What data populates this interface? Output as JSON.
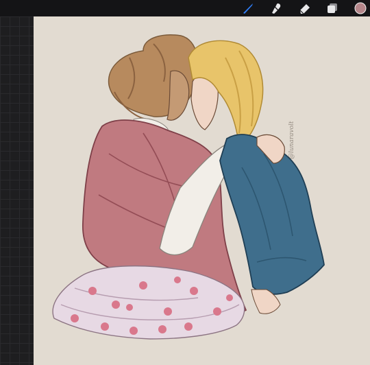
{
  "toolbar": {
    "tools": [
      {
        "name": "brush",
        "icon": "brush-icon",
        "color": "#2f7df6",
        "active": true
      },
      {
        "name": "smudge",
        "icon": "smudge-icon",
        "color": "#e8e8ea",
        "active": false
      },
      {
        "name": "eraser",
        "icon": "eraser-icon",
        "color": "#e8e8ea",
        "active": false
      },
      {
        "name": "layers",
        "icon": "layers-icon",
        "color": "#e8e8ea",
        "active": false
      }
    ],
    "current_color": "#b4868a"
  },
  "canvas": {
    "background": "#e2dbd1",
    "watermark": "@lunaravolt"
  },
  "colors": {
    "ui_dark": "#141416",
    "accent_blue": "#2f7df6",
    "pink_wrap": "#c07a80",
    "denim": "#3f6e8c",
    "blonde_hair": "#e8c46a",
    "brown_hair": "#b78a5e",
    "skirt": "#e7d9e4",
    "skirt_flower": "#d9788c"
  }
}
